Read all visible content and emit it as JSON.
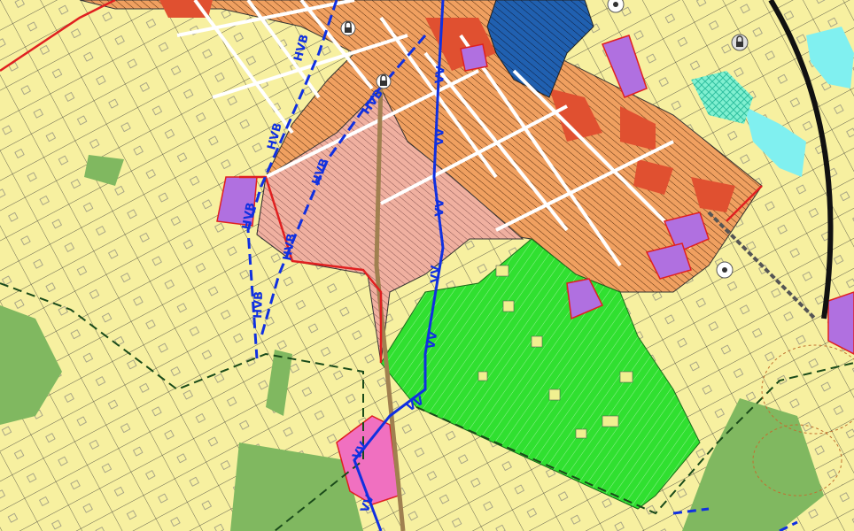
{
  "map": {
    "colors": {
      "agricultural": "#f7f0a0",
      "residential_dense": "#f0a060",
      "residential_low": "#f0b0a0",
      "commercial": "#e05030",
      "industrial": "#2060b0",
      "public": "#b070e0",
      "green": "#30e030",
      "green_dark": "#80b860",
      "pink_zone": "#f070c0",
      "water": "#80f0f0",
      "cyan_hatch": "#40e0c0",
      "boundary_red": "#e02020",
      "power_line": "#1030e0"
    },
    "line_labels": {
      "hv_a": "HVB",
      "hv_b": "HVB",
      "vv_a": "VV",
      "vv_b": "VV"
    },
    "icons": [
      "lock-icon",
      "lock-icon",
      "lock-icon",
      "target-icon",
      "target-icon"
    ]
  }
}
